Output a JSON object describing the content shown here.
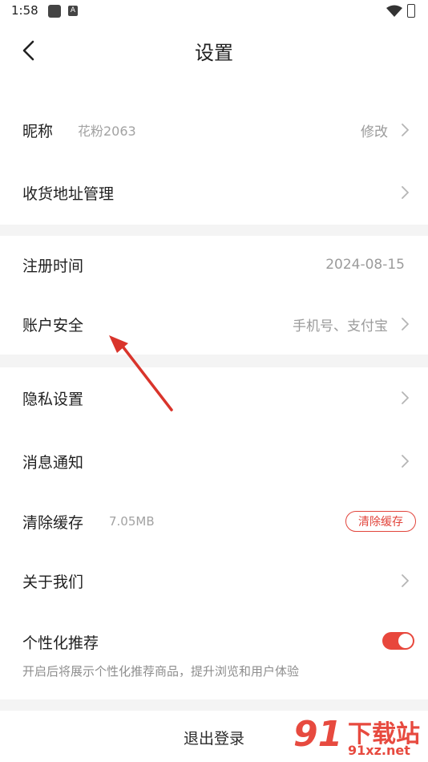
{
  "status_bar": {
    "time": "1:58",
    "notif_letter": "A"
  },
  "header": {
    "title": "设置"
  },
  "card1": {
    "nickname": {
      "label": "昵称",
      "value": "花粉2063",
      "action": "修改"
    },
    "address": {
      "label": "收货地址管理"
    }
  },
  "card2": {
    "register": {
      "label": "注册时间",
      "value": "2024-08-15"
    },
    "security": {
      "label": "账户安全",
      "value": "手机号、支付宝"
    }
  },
  "card3": {
    "privacy": {
      "label": "隐私设置"
    },
    "notify": {
      "label": "消息通知"
    },
    "cache": {
      "label": "清除缓存",
      "size": "7.05MB",
      "button": "清除缓存"
    },
    "about": {
      "label": "关于我们"
    },
    "personal": {
      "label": "个性化推荐",
      "enabled": true,
      "hint": "开启后将展示个性化推荐商品，提升浏览和用户体验"
    }
  },
  "logout": {
    "label": "退出登录"
  },
  "watermark": {
    "num": "91",
    "cn": "下载站",
    "en": "91xz.net"
  },
  "colors": {
    "accent": "#e2453c",
    "annotation_arrow": "#d9342b"
  }
}
